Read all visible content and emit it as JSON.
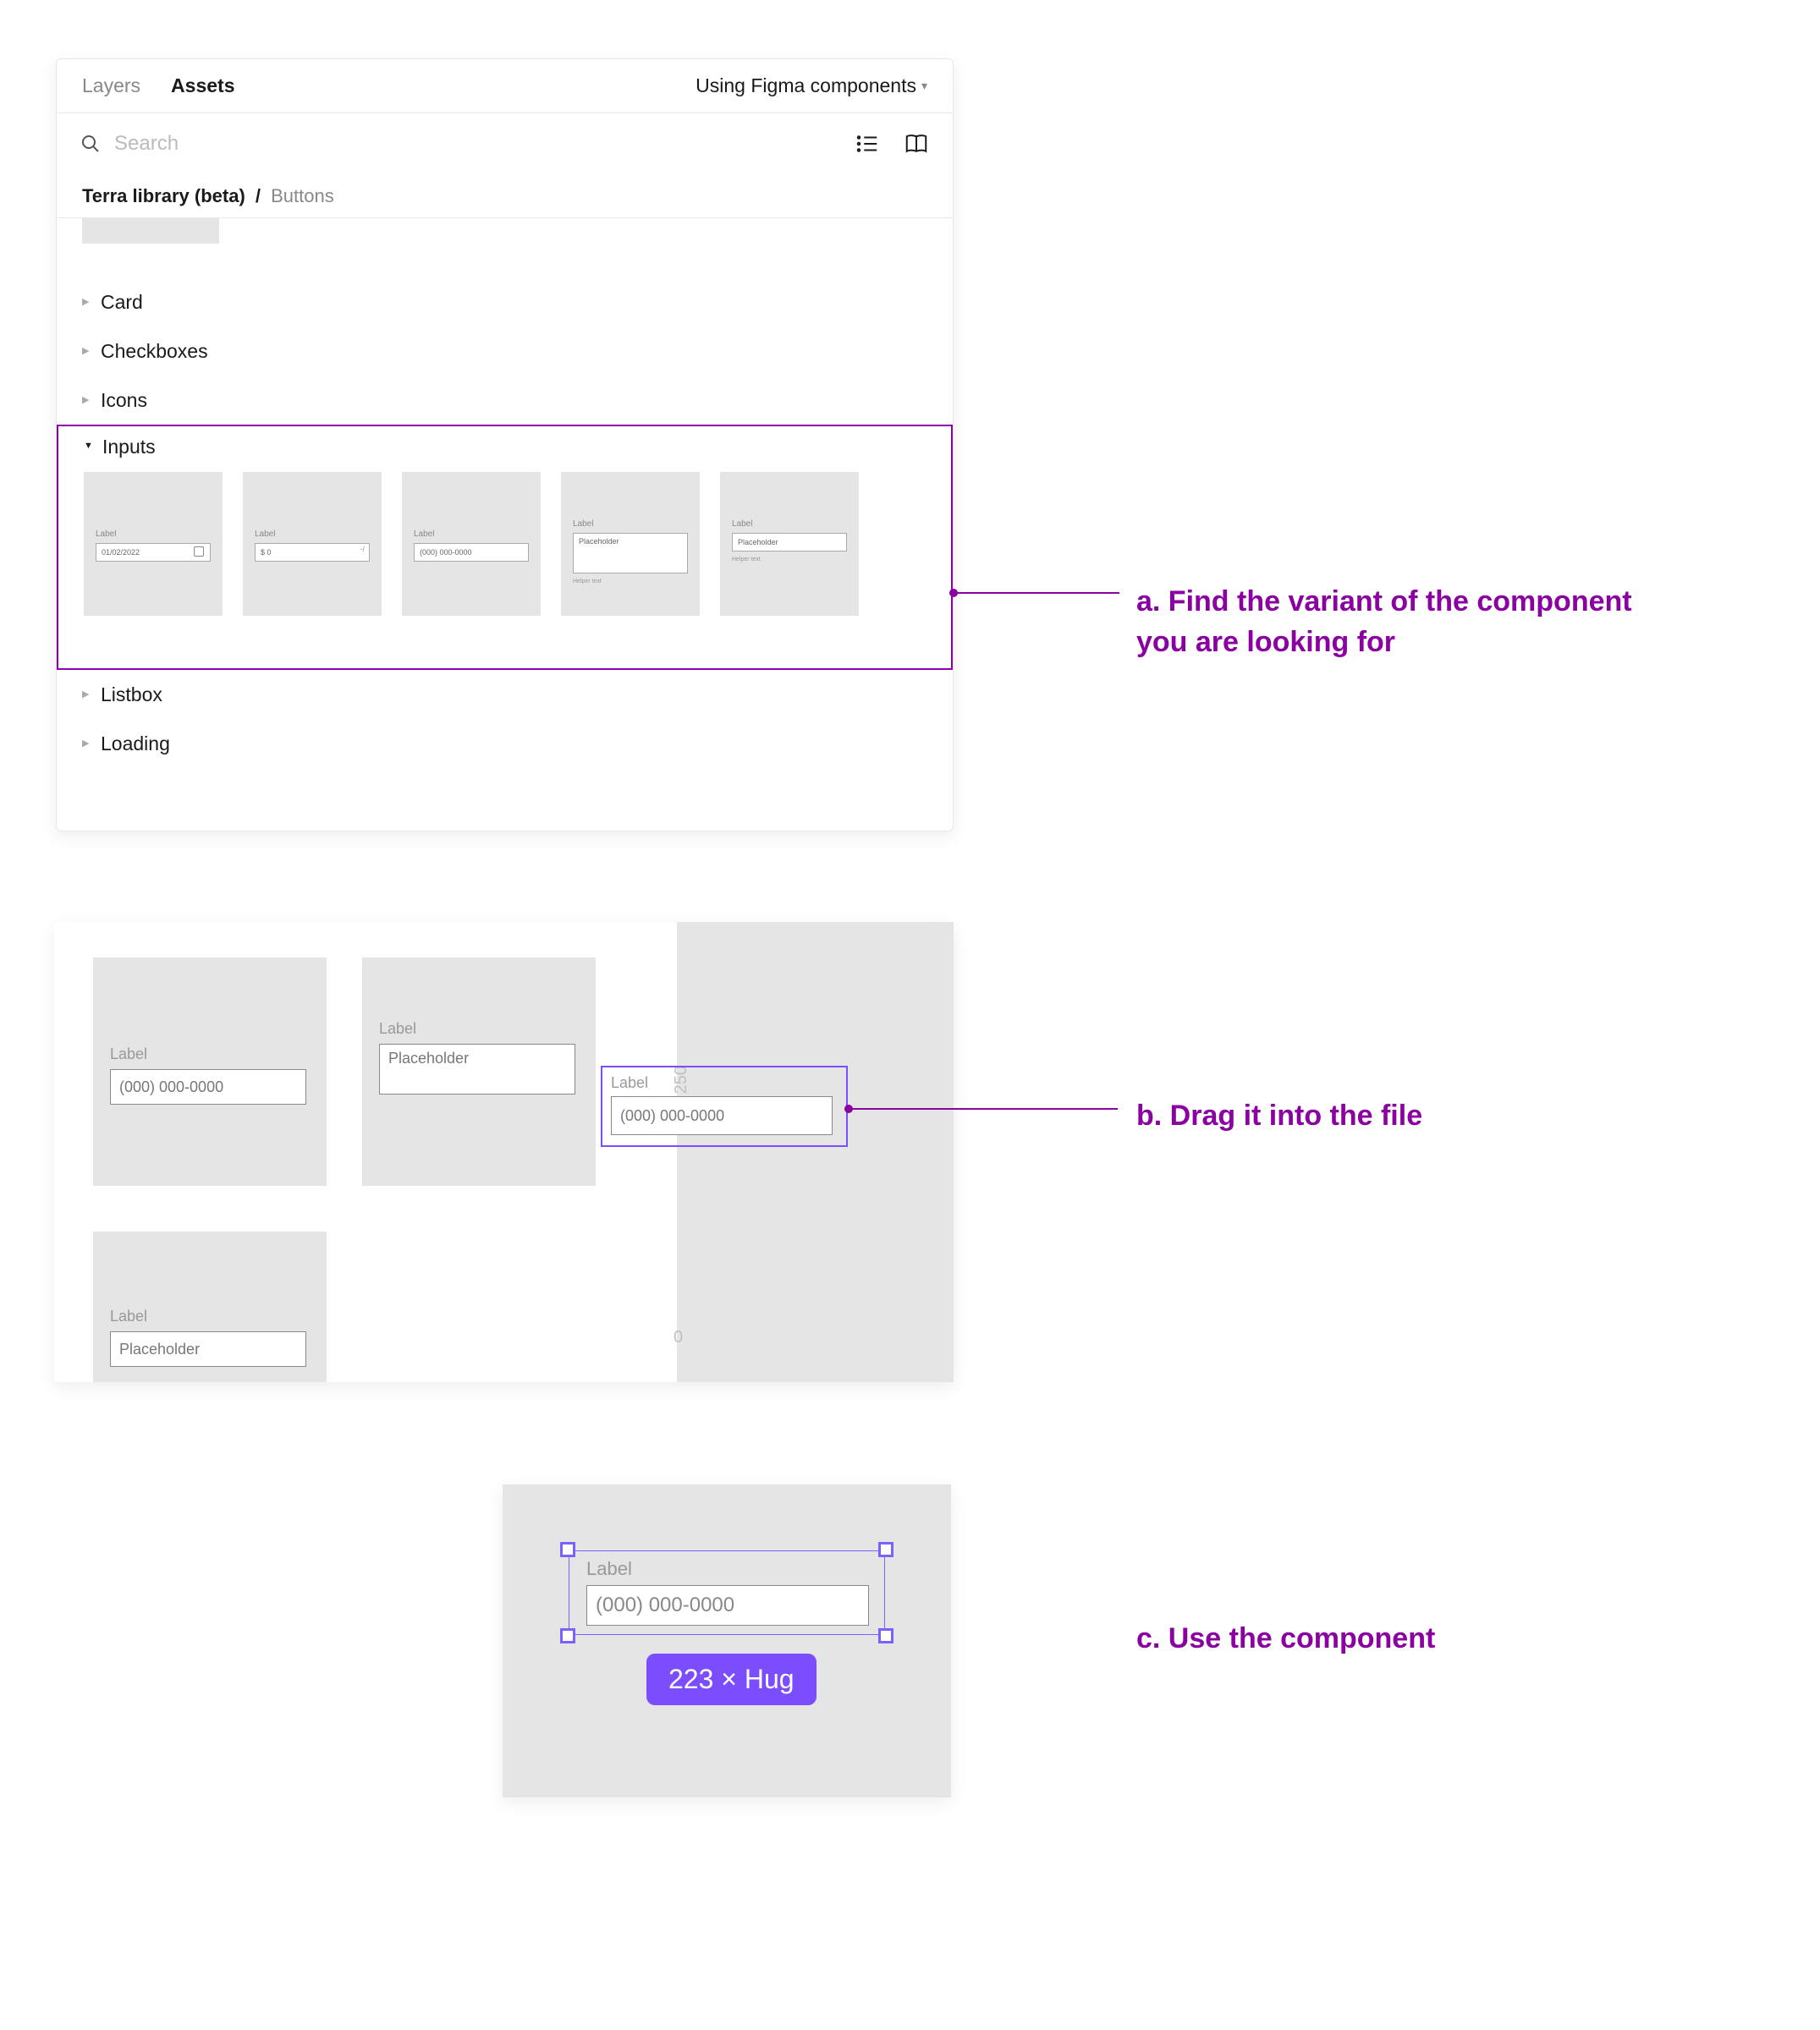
{
  "tabs": {
    "layers": "Layers",
    "assets": "Assets"
  },
  "pages_dropdown": "Using Figma components",
  "search": {
    "placeholder": "Search"
  },
  "breadcrumb": {
    "library": "Terra library (beta)",
    "page": "Buttons"
  },
  "tree": {
    "card": "Card",
    "checkboxes": "Checkboxes",
    "icons": "Icons",
    "inputs": "Inputs",
    "listbox": "Listbox",
    "loading": "Loading"
  },
  "input_tiles": {
    "label": "Label",
    "helper": "Helper text",
    "date_value": "01/02/2022",
    "money_value": "$ 0",
    "phone_value": "(000) 000-0000",
    "placeholder": "Placeholder"
  },
  "canvas_b": {
    "frame_label_v": "250",
    "frame_label_o": "0",
    "tile1": {
      "label": "Label",
      "value": "(000) 000-0000"
    },
    "tile2": {
      "label": "Label",
      "value": "Placeholder"
    },
    "tile3": {
      "label": "Label",
      "value": "Placeholder"
    },
    "dragged": {
      "label": "Label",
      "value": "(000) 000-0000"
    }
  },
  "canvas_c": {
    "label": "Label",
    "value": "(000) 000-0000",
    "size_badge": "223 × Hug"
  },
  "annotations": {
    "a": "a. Find the variant of the component you are looking for",
    "b": "b. Drag it into the file",
    "c": "c. Use the component"
  }
}
